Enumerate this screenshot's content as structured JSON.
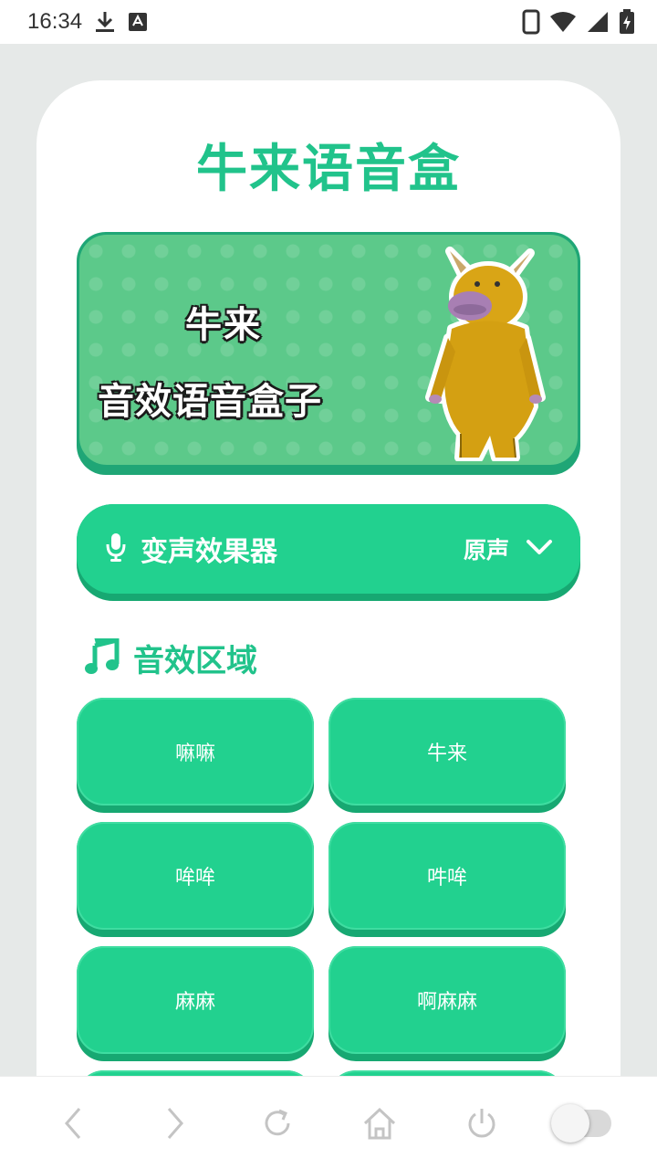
{
  "status_bar": {
    "time": "16:34",
    "icons": [
      "download-icon",
      "keyboard-a-icon",
      "phone-icon",
      "wifi-icon",
      "signal-icon",
      "battery-charging-icon"
    ]
  },
  "app": {
    "title": "牛来语音盒"
  },
  "banner": {
    "line1": "牛来",
    "line2": "音效语音盒子"
  },
  "voice_changer": {
    "label": "变声效果器",
    "value": "原声",
    "icon": "microphone-icon"
  },
  "sounds_section": {
    "title": "音效区域",
    "icon": "music-note-icon",
    "items": [
      {
        "label": "嘛嘛"
      },
      {
        "label": "牛来"
      },
      {
        "label": "哞哞"
      },
      {
        "label": "吽哞"
      },
      {
        "label": "麻麻"
      },
      {
        "label": "啊麻麻"
      }
    ]
  },
  "bottom_nav": {
    "items": [
      "back-icon",
      "forward-icon",
      "refresh-icon",
      "home-icon",
      "power-icon",
      "toggle-switch"
    ]
  },
  "colors": {
    "accent": "#21c38b",
    "button": "#22d18f",
    "button_shadow": "#17a872",
    "banner_bg": "#5cc98a"
  }
}
